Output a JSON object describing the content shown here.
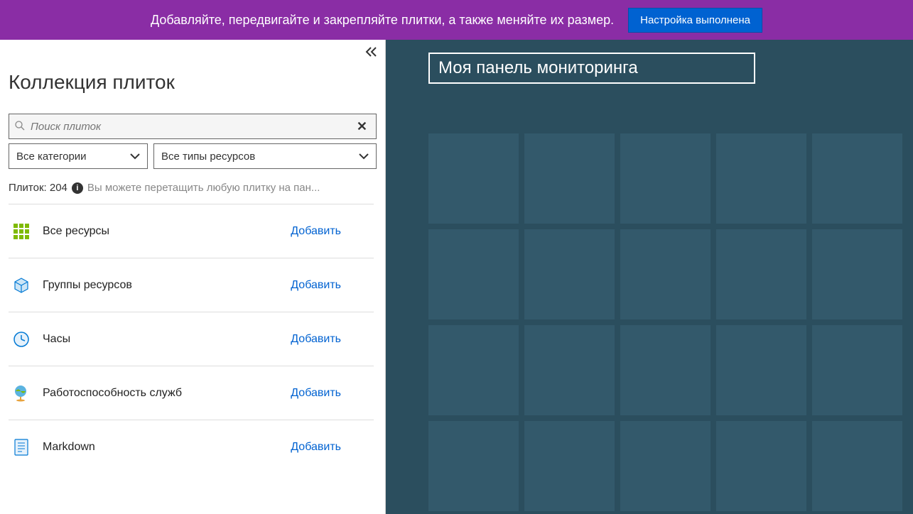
{
  "banner": {
    "text": "Добавляйте, передвигайте и закрепляйте плитки, а также меняйте их размер.",
    "button": "Настройка выполнена"
  },
  "sidebar": {
    "title": "Коллекция плиток",
    "search_placeholder": "Поиск плиток",
    "filter_category": "Все категории",
    "filter_type": "Все типы ресурсов",
    "count_label": "Плиток: 204",
    "count_hint": "Вы можете перетащить любую плитку на пан...",
    "add_label": "Добавить",
    "tiles": [
      {
        "icon": "grid-icon",
        "label": "Все ресурсы"
      },
      {
        "icon": "cube-icon",
        "label": "Группы ресурсов"
      },
      {
        "icon": "clock-icon",
        "label": "Часы"
      },
      {
        "icon": "globe-icon",
        "label": "Работоспособность служб"
      },
      {
        "icon": "doc-icon",
        "label": "Markdown"
      }
    ]
  },
  "dashboard": {
    "title": "Моя панель мониторинга",
    "grid_cells": 20
  }
}
